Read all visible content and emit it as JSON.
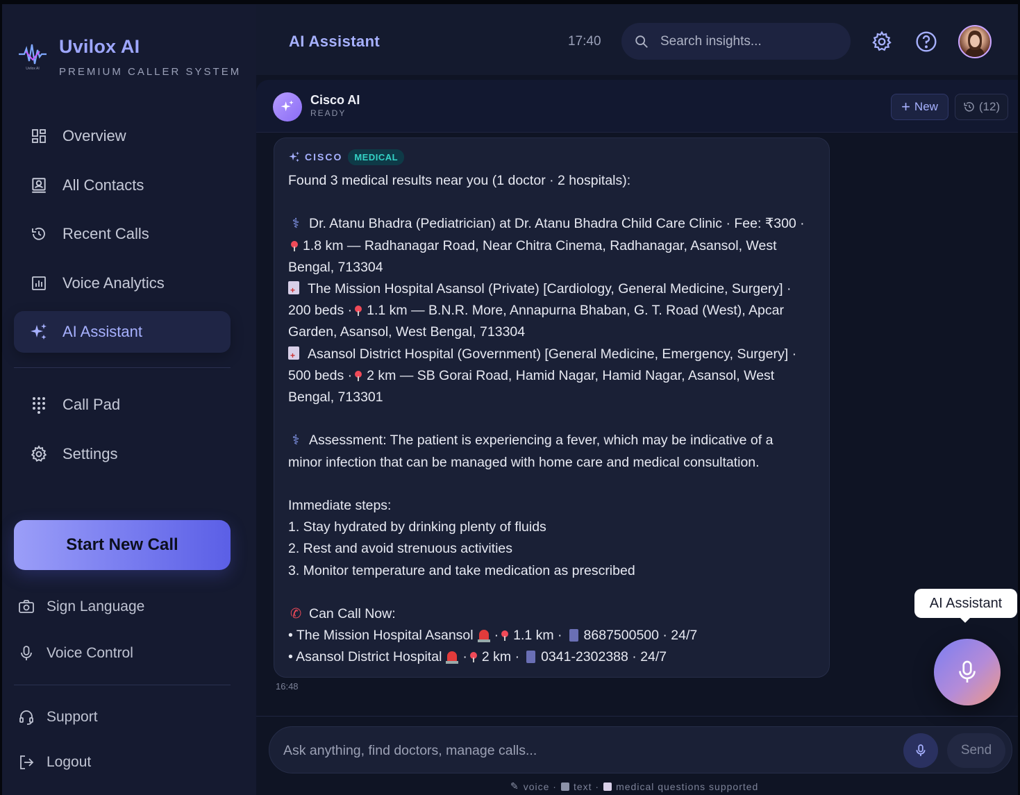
{
  "brand": {
    "name": "Uvilox AI",
    "tagline": "PREMIUM CALLER SYSTEM",
    "logo_text": "Uvilox AI"
  },
  "nav": {
    "items": [
      {
        "label": "Overview",
        "icon": "overview-icon"
      },
      {
        "label": "All Contacts",
        "icon": "contacts-icon"
      },
      {
        "label": "Recent Calls",
        "icon": "history-icon"
      },
      {
        "label": "Voice Analytics",
        "icon": "analytics-icon"
      },
      {
        "label": "AI Assistant",
        "icon": "sparkle-icon",
        "active": true
      },
      {
        "label": "Call Pad",
        "icon": "dialpad-icon"
      },
      {
        "label": "Settings",
        "icon": "gear-icon"
      }
    ],
    "start_call": "Start New Call",
    "bottom": [
      {
        "label": "Sign Language",
        "icon": "camera-icon"
      },
      {
        "label": "Voice Control",
        "icon": "mic-icon"
      },
      {
        "label": "Support",
        "icon": "headset-icon"
      },
      {
        "label": "Logout",
        "icon": "logout-icon"
      }
    ]
  },
  "header": {
    "title": "AI Assistant",
    "time": "17:40",
    "search_placeholder": "Search insights..."
  },
  "chat": {
    "bot_name": "Cisco AI",
    "bot_status": "READY",
    "new_label": "New",
    "history_count": "(12)",
    "message": {
      "tag_sender": "CISCO",
      "tag_category": "MEDICAL",
      "intro": "Found 3 medical results near you (1 doctor · 2 hospitals):",
      "r1_a": "Dr. Atanu Bhadra (Pediatrician) at Dr. Atanu Bhadra Child Care Clinic · Fee: ₹300 ·",
      "r1_b": "1.8 km — Radhanagar Road, Near Chitra Cinema, Radhanagar, Asansol, West",
      "r1_c": "Bengal, 713304",
      "r2_a": "The Mission Hospital Asansol (Private) [Cardiology, General Medicine, Surgery] ·",
      "r2_b1": "200 beds ·",
      "r2_b2": "1.1 km — B.N.R. More, Annapurna Bhaban, G. T. Road (West), Apcar",
      "r2_c": "Garden, Asansol, West Bengal, 713304",
      "r3_a": "Asansol District Hospital (Government) [General Medicine, Emergency, Surgery] ·",
      "r3_b1": "500 beds ·",
      "r3_b2": "2 km — SB Gorai Road, Hamid Nagar, Hamid Nagar, Asansol, West",
      "r3_c": "Bengal, 713301",
      "assess_a": "Assessment: The patient is experiencing a fever, which may be indicative of a",
      "assess_b": "minor infection that can be managed with home care and medical consultation.",
      "steps_title": "Immediate steps:",
      "step1": "1. Stay hydrated by drinking plenty of fluids",
      "step2": "2. Rest and avoid strenuous activities",
      "step3": "3. Monitor temperature and take medication as prescribed",
      "call_title": "Can Call Now:",
      "c1_name": "• The Mission Hospital Asansol",
      "c1_dist": "1.1 km ·",
      "c1_phone": "8687500500 · 24/7",
      "c2_name": "• Asansol District Hospital",
      "c2_dist": "2 km ·",
      "c2_phone": "0341-2302388 · 24/7"
    },
    "timestamp": "16:48",
    "fab_tooltip": "AI Assistant",
    "input_placeholder": "Ask anything, find doctors, manage calls...",
    "send_label": "Send",
    "hint_voice": "voice ·",
    "hint_text": "text ·",
    "hint_medical": "medical questions supported"
  },
  "colors": {
    "accent": "#a7b1ff",
    "background": "#0f1424",
    "sidebar": "#151a30",
    "medical_badge": "#34d3c6"
  }
}
